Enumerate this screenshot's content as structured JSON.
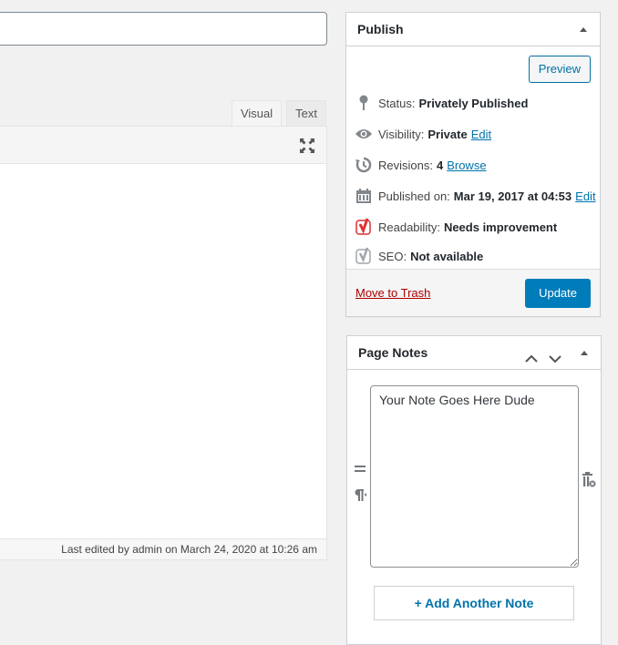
{
  "editor": {
    "title_value": "",
    "tabs": [
      {
        "label": "Visual",
        "active": true
      },
      {
        "label": "Text",
        "active": false
      }
    ],
    "fullscreen_icon": "fullscreen-icon",
    "status_text": "Last edited by admin on March 24, 2020 at 10:26 am"
  },
  "publish": {
    "title": "Publish",
    "preview_label": "Preview",
    "status": {
      "label": "Status:",
      "value": "Privately Published",
      "icon": "pin-icon"
    },
    "visibility": {
      "label": "Visibility:",
      "value": "Private",
      "link": "Edit",
      "icon": "eye-icon"
    },
    "revisions": {
      "label": "Revisions:",
      "value": "4",
      "link": "Browse",
      "icon": "history-icon"
    },
    "published_on": {
      "label": "Published on:",
      "value": "Mar 19, 2017 at 04:53",
      "link": "Edit",
      "icon": "calendar-icon"
    },
    "readability": {
      "label": "Readability:",
      "value": "Needs improvement",
      "icon": "yoast-icon",
      "color": "#dc3232"
    },
    "seo": {
      "label": "SEO:",
      "value": "Not available",
      "icon": "yoast-icon",
      "color": "#a0a5aa"
    },
    "trash_label": "Move to Trash",
    "update_label": "Update"
  },
  "page_notes": {
    "title": "Page Notes",
    "note_value": "Your Note Goes Here Dude",
    "add_label": "+ Add Another Note"
  },
  "colors": {
    "accent": "#0073aa",
    "primary_button": "#007cba",
    "trash": "#a00000"
  }
}
